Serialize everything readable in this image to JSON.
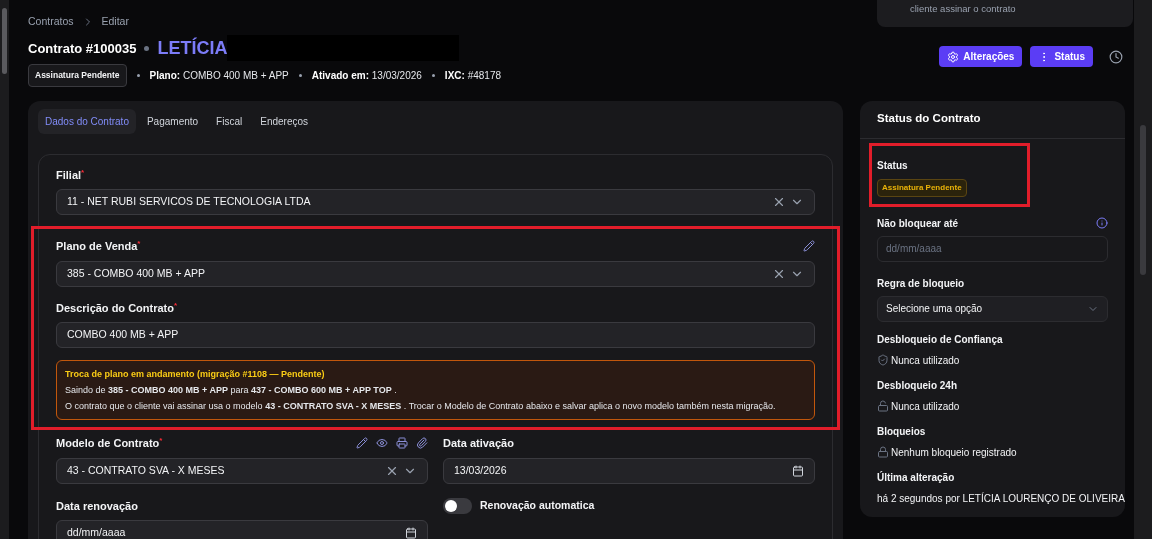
{
  "notice_card": {
    "text": "cliente assinar o contrato"
  },
  "breadcrumb": [
    {
      "label": "Contratos"
    },
    {
      "label": "Editar"
    }
  ],
  "header": {
    "title": "Contrato #100035",
    "client_name": "LETÍCIA",
    "status_badge": "Assinatura Pendente",
    "meta": [
      {
        "label": "Plano:",
        "value": "COMBO 400 MB + APP"
      },
      {
        "label": "Ativado em:",
        "value": "13/03/2026"
      },
      {
        "label": "IXC:",
        "value": "#48178"
      }
    ]
  },
  "actions": [
    {
      "kind": "gear",
      "label": "Alterações"
    },
    {
      "kind": "dots",
      "label": "Status"
    }
  ],
  "tabs": [
    {
      "label": "Dados do Contrato",
      "selected": true
    },
    {
      "label": "Pagamento",
      "selected": false
    },
    {
      "label": "Fiscal",
      "selected": false
    },
    {
      "label": "Endereços",
      "selected": false
    }
  ],
  "form": {
    "filial": {
      "label": "Filial",
      "marker": "*",
      "value": "11 - NET RUBI SERVICOS DE TECNOLOGIA LTDA"
    },
    "plano": {
      "label": "Plano de Venda",
      "marker": "*",
      "value": "385 - COMBO 400 MB + APP"
    },
    "descricao": {
      "label": "Descrição do Contrato",
      "marker": "*",
      "value": "COMBO 400 MB + APP"
    },
    "alert": {
      "title": "Troca de plano em andamento (migração #1108 — Pendente)",
      "lines": [
        "Saindo de **385 - COMBO 400 MB + APP** para **437 - COMBO 600 MB + APP TOP** .",
        "O contrato que o cliente vai assinar usa o modelo **43 - CONTRATO SVA - X MESES** . Trocar o Modelo de Contrato abaixo e salvar aplica o novo modelo também nesta migração."
      ]
    },
    "modelo": {
      "label": "Modelo de Contrato",
      "marker": "*",
      "value": "43 - CONTRATO SVA - X MESES"
    },
    "data_ativacao": {
      "label": "Data ativação",
      "value": "13/03/2026"
    },
    "data_renovacao": {
      "label": "Data renovação",
      "value": "dd/mm/aaaa"
    },
    "renovacao_auto": {
      "label": "Renovação automatica",
      "on": false
    }
  },
  "status_panel": {
    "title": "Status do Contrato",
    "status_label": "Status",
    "status_badge": "Assinatura Pendente",
    "nao_bloquear": {
      "label": "Não bloquear até",
      "placeholder": "dd/mm/aaaa"
    },
    "regra": {
      "label": "Regra de bloqueio",
      "value": "Selecione uma opção"
    },
    "info": [
      {
        "kind": "shield",
        "label": "Desbloqueio de Confiança",
        "value": "Nunca utilizado"
      },
      {
        "kind": "unlock",
        "label": "Desbloqueio 24h",
        "value": "Nunca utilizado"
      },
      {
        "kind": "lock",
        "label": "Bloqueios",
        "value": "Nenhum bloqueio registrado"
      },
      {
        "kind": "plain",
        "label": "Última alteração",
        "value": "há 2 segundos por LETÍCIA LOURENÇO DE OLIVEIRA"
      }
    ]
  }
}
